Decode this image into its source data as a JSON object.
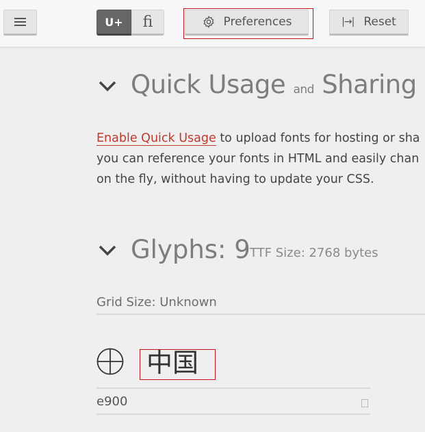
{
  "toolbar": {
    "unicode_label": "U+",
    "ligature_label": "fi",
    "preferences_label": "Preferences",
    "reset_label": "Reset"
  },
  "quick_usage": {
    "title_part1": "Quick Usage",
    "title_and": "and",
    "title_part2": "Sharing",
    "link_text": "Enable Quick Usage",
    "line1_rest": " to upload fonts for hosting or sha",
    "line2": "you can reference your fonts in HTML and easily chan",
    "line3": "on the fly, without having to update your CSS."
  },
  "glyphs": {
    "title": "Glyphs:",
    "count": "9",
    "ttf_size": "TTF Size: 2768 bytes",
    "grid_size": "Grid Size: Unknown",
    "items": [
      {
        "name": "中国",
        "code": "e900",
        "icon": "circle-plus-icon"
      }
    ]
  },
  "colors": {
    "accent_link": "#c0392b",
    "highlight_outline": "#c4141b",
    "active_toggle": "#666666",
    "background": "#efefef"
  }
}
